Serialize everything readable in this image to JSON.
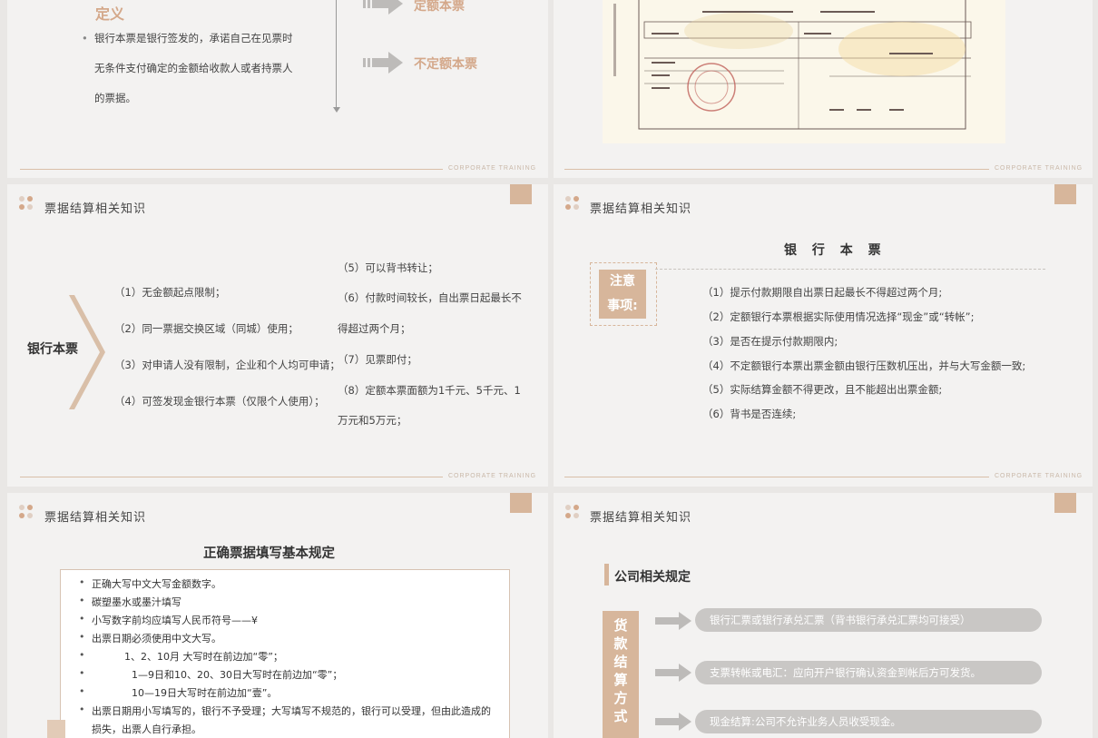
{
  "footer_text": "CORPORATE TRAINING",
  "section_header": "票据结算相关知识",
  "colors": {
    "accent": "#d4a88a",
    "tan": "#d7b69b",
    "pill": "#c9c7c5",
    "background": "#f3f2f1"
  },
  "slide1": {
    "def_title": "定义",
    "def_lines": [
      "银行本票是银行签发的，承诺自己在见票时",
      "无条件支付确定的金额给收款人或者持票人",
      "的票据。"
    ],
    "types": [
      "定额本票",
      "不定额本票"
    ]
  },
  "slide2": {
    "image": "bank-draft-cheque-image"
  },
  "slide3": {
    "label": "银行本票",
    "left_items": [
      "（1）无金额起点限制；",
      "（2）同一票据交换区域（同城）使用；",
      "（3）对申请人没有限制，企业和个人均可申请；",
      "（4）可签发现金银行本票（仅限个人使用）；"
    ],
    "right_items": [
      "（5）可以背书转让；",
      "（6）付款时间较长，自出票日起最长不",
      "得超过两个月；",
      "（7）见票即付；",
      "（8）定额本票面额为1千元、5千元、1",
      "万元和5万元；"
    ]
  },
  "slide4": {
    "title": "银 行 本 票",
    "note_label_line1": "注意",
    "note_label_line2": "事项:",
    "items": [
      "（1）提示付款期限自出票日起最长不得超过两个月;",
      "（2）定额银行本票根据实际使用情况选择“现金”或“转帐”;",
      "（3）是否在提示付款期限内;",
      "（4）不定额银行本票出票金额由银行压数机压出，并与大写金额一致;",
      "（5）实际结算金额不得更改，且不能超出出票金额;",
      "（6）背书是否连续;"
    ]
  },
  "slide5": {
    "title": "正确票据填写基本规定",
    "rules": [
      "正确大写中文大写金额数字。",
      "碳塑墨水或墨汁填写",
      "小写数字前均应填写人民币符号——¥",
      "出票日期必须使用中文大写。",
      "1、2、10月 大写时在前边加“零”；",
      "1—9日和10、20、30日大写时在前边加“零”；",
      "10—19日大写时在前边加“壹”。",
      "出票日期用小写填写的，银行不予受理；大写填写不规范的，银行可以受理，但由此造成的",
      "损失，出票人自行承担。"
    ]
  },
  "slide6": {
    "title": "公司相关规定",
    "vertical_label": [
      "货",
      "款",
      "结",
      "算",
      "方",
      "式"
    ],
    "pills": [
      "银行汇票或银行承兑汇票（背书银行承兑汇票均可接受）",
      "支票转帐或电汇：应向开户银行确认资金到帐后方可发货。",
      "现金结算:公司不允许业务人员收受现金。"
    ]
  }
}
